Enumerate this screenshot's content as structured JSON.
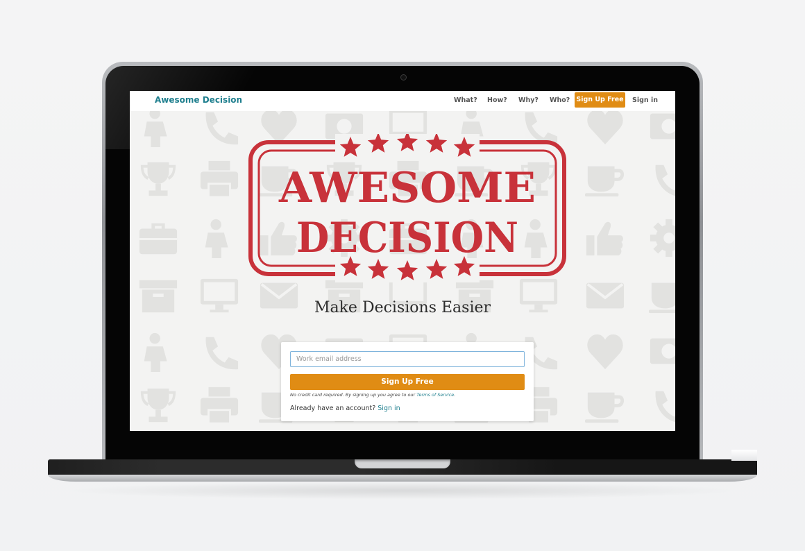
{
  "nav": {
    "brand": "Awesome Decision",
    "links": [
      "What?",
      "How?",
      "Why?",
      "Who?"
    ],
    "cta": "Sign Up Free",
    "signin": "Sign in"
  },
  "hero": {
    "stamp_line1": "AWESOME",
    "stamp_line2": "DECISION",
    "tagline": "Make Decisions Easier"
  },
  "signup": {
    "email_placeholder": "Work email address",
    "button": "Sign Up Free",
    "fine_print": "No credit card required. By signing up you agree to our ",
    "tos_link": "Terms of Service",
    "fine_print_end": ".",
    "already": "Already have an account? ",
    "signin_link": "Sign in"
  },
  "colors": {
    "accent": "#e08c14",
    "brand": "#1f7f8e",
    "stamp": "#c8323a",
    "pattern": "#e2e2e0"
  },
  "pattern_icons": [
    "person-icon",
    "phone-icon",
    "heart-icon",
    "money-icon",
    "monitor-icon",
    "trophy-icon",
    "printer-icon",
    "coffee-icon",
    "briefcase-icon",
    "thumbs-up-icon",
    "gear-icon",
    "box-icon",
    "mail-icon"
  ]
}
